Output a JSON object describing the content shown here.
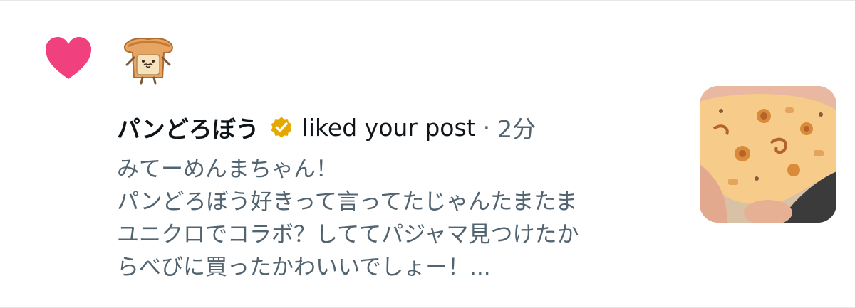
{
  "notification": {
    "type_icon": "heart-icon",
    "accent_color": "#f0407e",
    "avatar_icon": "bread-character-avatar",
    "author": "パンどろぼう",
    "verified_badge": "gold-check-icon",
    "verified_color": "#e5a800",
    "action": "liked your post",
    "separator": "·",
    "time": "2分",
    "preview_lines": [
      "みてーめんまちゃん！",
      "パンどろぼう好きって言ってたじゃんたまたま",
      "ユニクロでコラボ？しててパジャマ見つけたか",
      "らべびに買ったかわいいでしょー！..."
    ],
    "thumbnail": "baby-in-bread-print-pajamas-photo"
  }
}
